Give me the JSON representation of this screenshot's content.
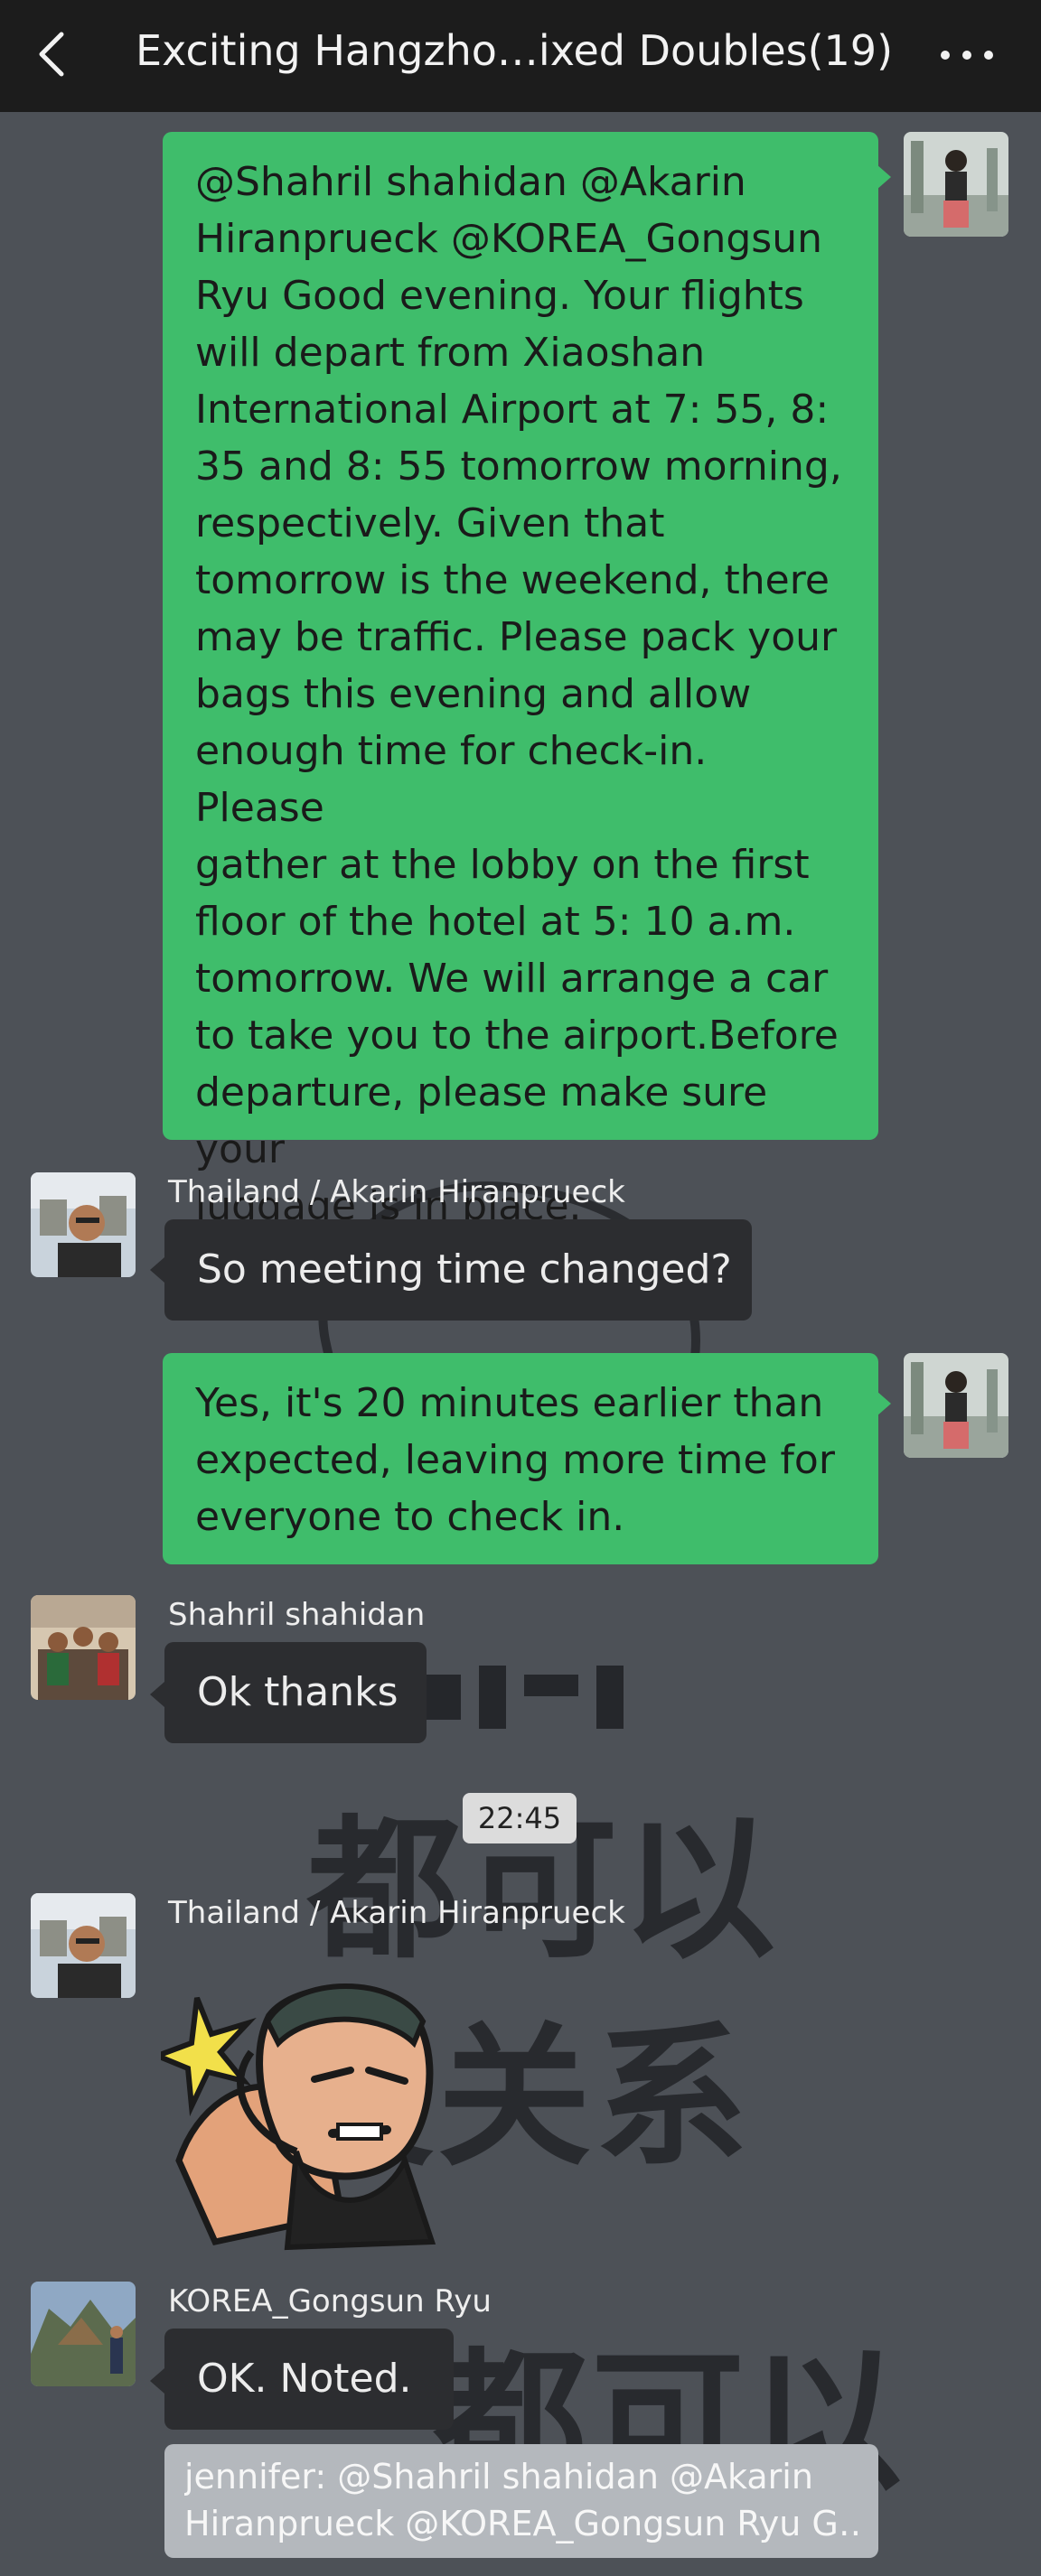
{
  "header": {
    "title": "Exciting Hangzho…ixed Doubles(19)",
    "back_icon": "chevron-left-icon",
    "more_icon": "more-horizontal-icon"
  },
  "colors": {
    "outgoing_bubble": "#3fbd6b",
    "incoming_bubble": "#2c2d30",
    "chat_background": "#4d5157",
    "topbar": "#1c1c1c"
  },
  "wallpaper": {
    "row1": "都可以",
    "row2": "没关系",
    "row3": "都可以"
  },
  "messages": [
    {
      "direction": "outgoing",
      "lines": [
        "@Shahril shahidan @Akarin",
        "Hiranprueck @KOREA_Gongsun",
        "Ryu Good evening. Your flights",
        "will depart from Xiaoshan",
        "International Airport at 7: 55, 8:",
        "35 and 8: 55 tomorrow morning,",
        "respectively. Given that",
        "tomorrow is the weekend, there",
        "may be traffic. Please pack your",
        "bags this evening and allow",
        "enough time for check-in. Please",
        "gather at the lobby on the first",
        "floor of the hotel at 5: 10 a.m.",
        "tomorrow. We will arrange a car",
        "to take you to the airport.Before",
        "departure, please make sure your",
        "luggage is in place."
      ]
    },
    {
      "direction": "incoming",
      "sender": "Thailand / Akarin Hiranprueck",
      "text": "So meeting time changed?"
    },
    {
      "direction": "outgoing",
      "lines": [
        "Yes, it's 20 minutes earlier than",
        "expected, leaving more time for",
        "everyone to check in."
      ]
    },
    {
      "direction": "incoming",
      "sender": "Shahril shahidan",
      "text": "Ok thanks"
    },
    {
      "direction": "incoming",
      "sender": "Thailand / Akarin Hiranprueck",
      "sticker": "saluting-man-sticker"
    },
    {
      "direction": "incoming",
      "sender": "KOREA_Gongsun Ryu",
      "text": "OK. Noted."
    }
  ],
  "timestamp": "22:45",
  "quote": {
    "line1": "jennifer:  @Shahril shahidan @Akarin",
    "line2": "Hiranprueck @KOREA_Gongsun Ryu G…"
  }
}
